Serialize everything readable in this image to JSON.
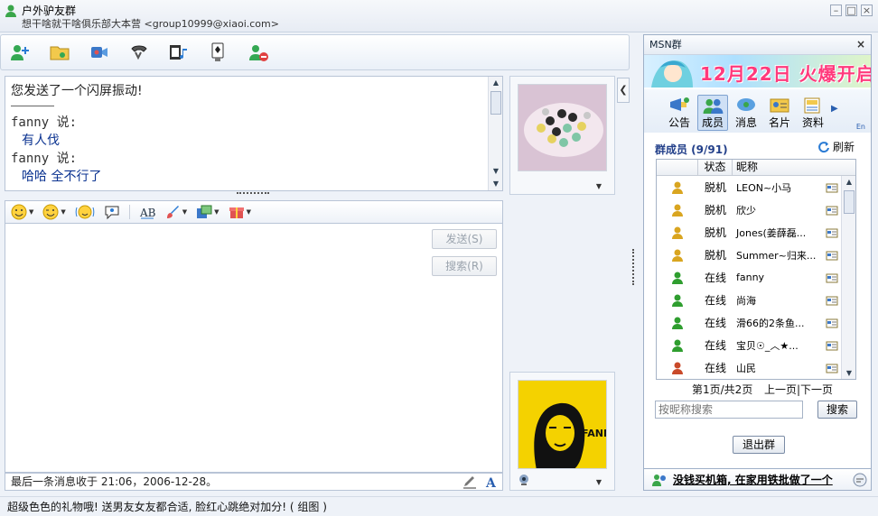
{
  "window": {
    "title": "户外驴友群",
    "subtitle": "想干啥就干啥俱乐部大本营 <group10999@xiaoi.com>",
    "buttons": [
      "minimize",
      "maximize",
      "close"
    ]
  },
  "toolbar": {
    "icons": [
      "invite-contact-icon",
      "send-file-icon",
      "video-chat-icon",
      "voice-call-icon",
      "media-icon",
      "games-icon",
      "block-icon"
    ]
  },
  "chatlog": {
    "messages": [
      {
        "type": "system",
        "text": "您发送了一个闪屏振动!"
      },
      {
        "type": "name",
        "text": "fanny 说:"
      },
      {
        "type": "body",
        "text": "有人伐"
      },
      {
        "type": "name",
        "text": "fanny 说:"
      },
      {
        "type": "body",
        "text": "哈哈  全不行了"
      }
    ]
  },
  "compose": {
    "send_label": "发送(S)",
    "search_label": "搜索(R)",
    "status_text": "最后一条消息收于 21:06，2006-12-28。"
  },
  "side": {
    "header_title": "MSN群",
    "banner_text": "12月22日 火爆开启",
    "tabs": [
      {
        "label": "公告",
        "icon": "announce-icon"
      },
      {
        "label": "成员",
        "icon": "members-icon"
      },
      {
        "label": "消息",
        "icon": "message-icon"
      },
      {
        "label": "名片",
        "icon": "card-icon"
      },
      {
        "label": "资料",
        "icon": "info-icon"
      }
    ],
    "tab_more": "▶",
    "tab_lang": "En",
    "members_title": "群成员 (9/91)",
    "refresh_label": "刷新",
    "columns": {
      "status": "状态",
      "nick": "昵称"
    },
    "members": [
      {
        "status": "脱机",
        "nick": "LEON~小马",
        "kind": "offline-a"
      },
      {
        "status": "脱机",
        "nick": "欣少",
        "kind": "offline-b"
      },
      {
        "status": "脱机",
        "nick": "Jones(姜薛磊...",
        "kind": "offline-b"
      },
      {
        "status": "脱机",
        "nick": "Summer~归来...",
        "kind": "offline-b"
      },
      {
        "status": "在线",
        "nick": "fanny",
        "kind": "online"
      },
      {
        "status": "在线",
        "nick": "尚海",
        "kind": "online"
      },
      {
        "status": "在线",
        "nick": "滑66的2条鱼...",
        "kind": "online"
      },
      {
        "status": "在线",
        "nick": "宝贝☉_︿★...",
        "kind": "online"
      },
      {
        "status": "在线",
        "nick": "山民",
        "kind": "online-red"
      }
    ],
    "pager_info": "第1页/共2页",
    "pager_nav": "上一页|下一页",
    "search_placeholder": "按昵称搜索",
    "search_button": "搜索",
    "leave_button": "退出群",
    "footer_link": "没钱买机箱, 在家用铁批做了一个"
  },
  "ad_text": "超级色色的礼物哦! 送男友女友都合适, 脸红心跳绝对加分! ( 组图 )",
  "colors": {
    "accent": "#23408a",
    "online": "#2f9e2f",
    "offline": "#d9a520",
    "banner": "#ff3a7c"
  }
}
